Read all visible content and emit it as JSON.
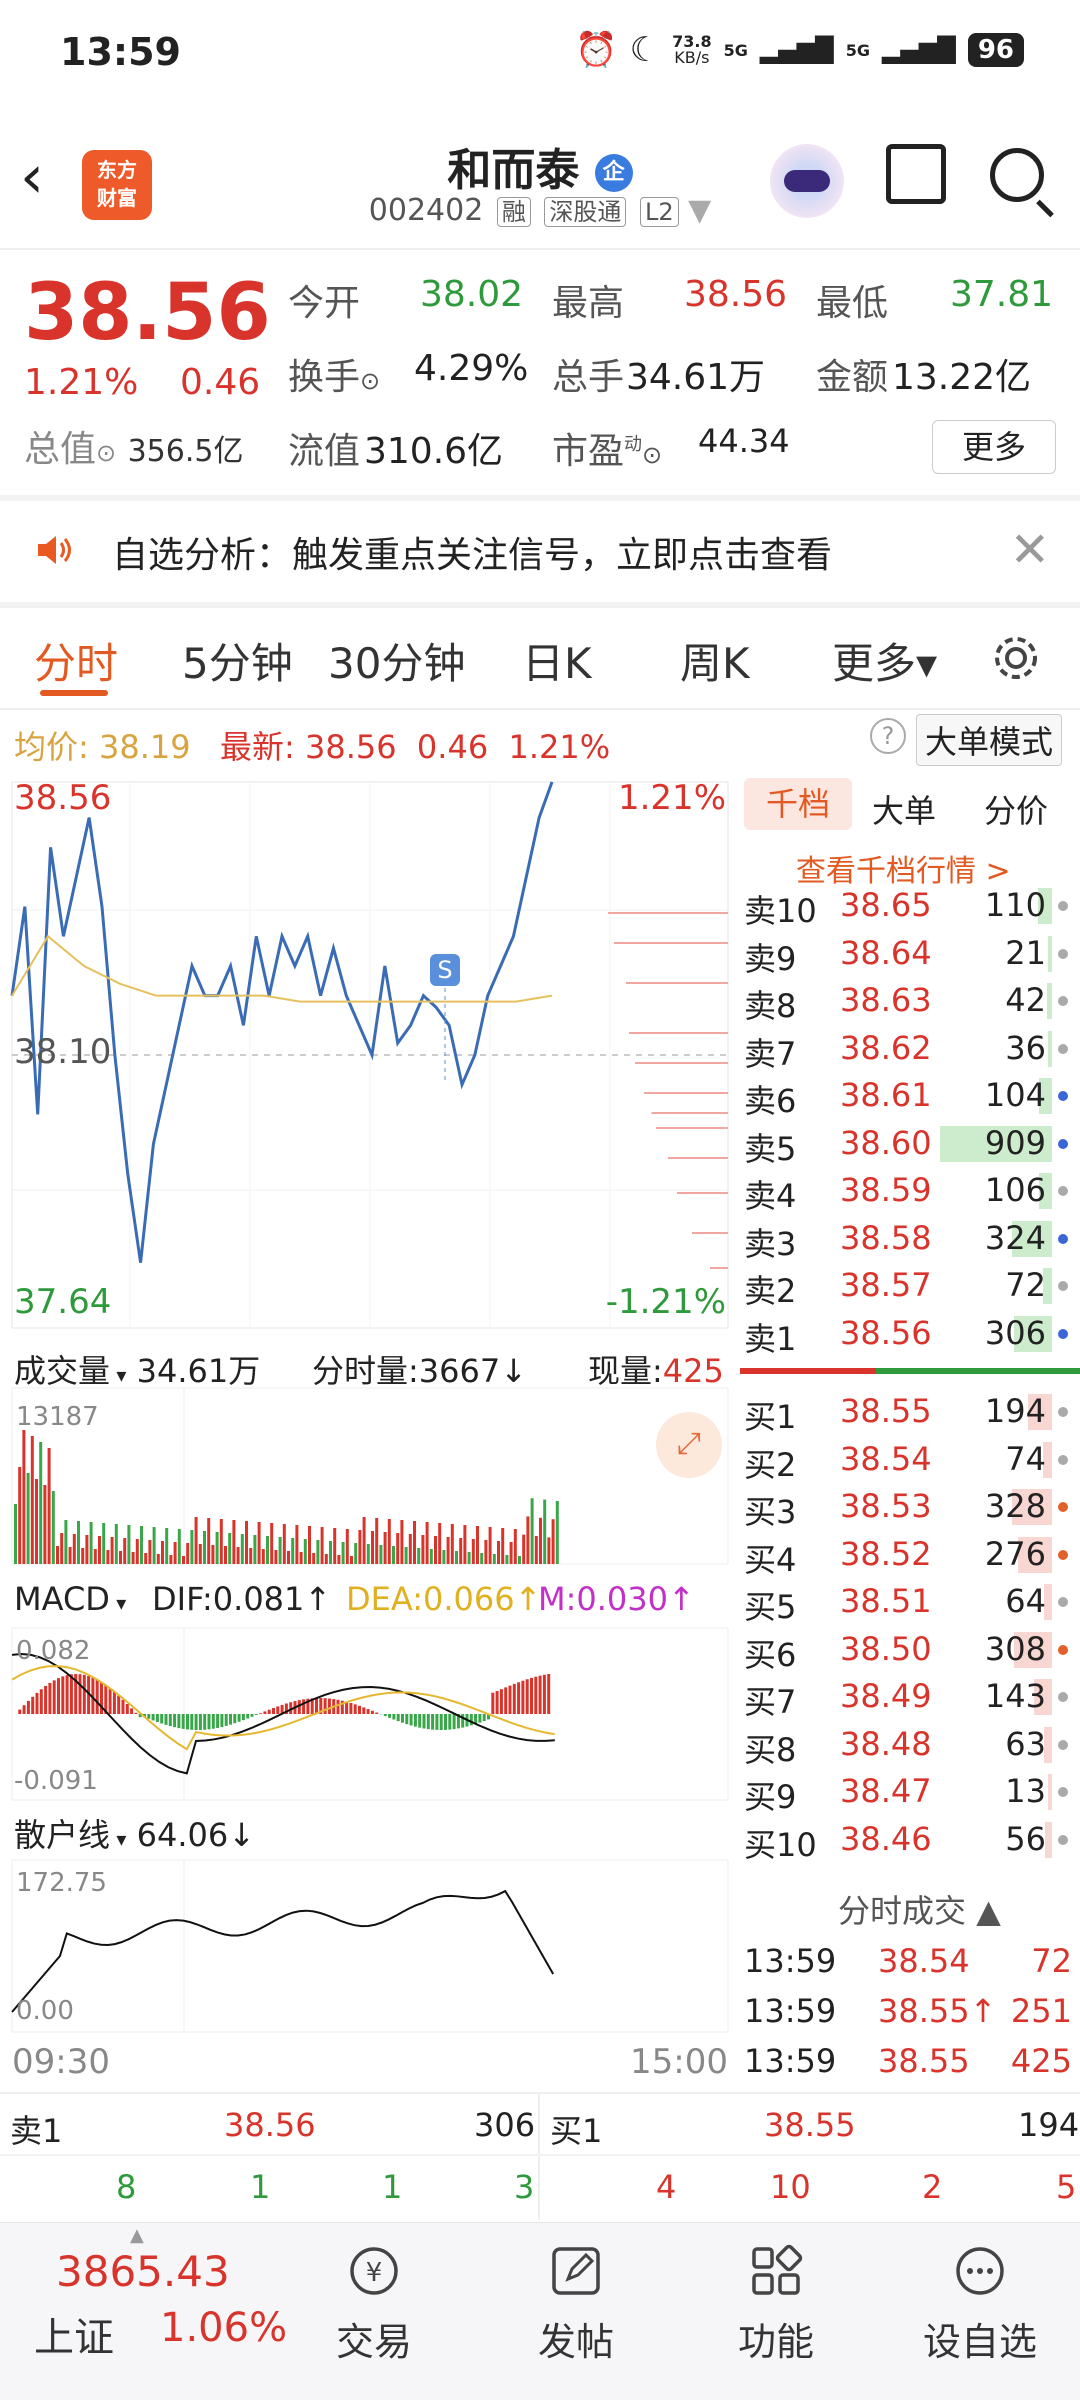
{
  "status": {
    "time": "13:59",
    "net_speed": "73.8",
    "net_unit": "KB/s",
    "sig1": "5G",
    "sig2": "5G",
    "battery": "96"
  },
  "header": {
    "logo_line1": "东方",
    "logo_line2": "财富",
    "name": "和而泰",
    "badge": "企",
    "code": "002402",
    "tag1": "融",
    "tag2": "深股通",
    "tag3": "L2"
  },
  "quote": {
    "price": "38.56",
    "pct": "1.21%",
    "chg": "0.46",
    "open_label": "今开",
    "open": "38.02",
    "high_label": "最高",
    "high": "38.56",
    "low_label": "最低",
    "low": "37.81",
    "turnover_label": "换手",
    "turnover": "4.29%",
    "vol_label": "总手",
    "vol": "34.61万",
    "amount_label": "金额",
    "amount": "13.22亿",
    "mcap_label": "总值",
    "mcap": "356.5亿",
    "float_label": "流值",
    "float": "310.6亿",
    "pe_label": "市盈",
    "pe_sup": "动",
    "pe": "44.34",
    "more": "更多"
  },
  "notice": {
    "text": "自选分析：触发重点关注信号，立即点击查看"
  },
  "tabs": [
    "分时",
    "5分钟",
    "30分钟",
    "日K",
    "周K",
    "更多▾"
  ],
  "infobar": {
    "avg_label": "均价:",
    "avg": "38.19",
    "latest_label": "最新:",
    "latest": "38.56",
    "chg": "0.46",
    "pct": "1.21%",
    "mode": "大单模式"
  },
  "chart_data": {
    "type": "line",
    "title": "",
    "x_start": "09:30",
    "x_end": "15:00",
    "ylim": [
      37.64,
      38.56
    ],
    "y_top_label": "38.56",
    "y_mid_label": "38.10",
    "y_bottom_label": "37.64",
    "pct_top": "1.21%",
    "pct_bottom": "-1.21%",
    "marker": "S",
    "series": [
      {
        "values": [
          38.2,
          38.35,
          38.0,
          38.45,
          38.3,
          38.4,
          38.5,
          38.35,
          38.1,
          37.9,
          37.75,
          37.95,
          38.05,
          38.15,
          38.25,
          38.2,
          38.2,
          38.25,
          38.15,
          38.3,
          38.2,
          38.3,
          38.25,
          38.3,
          38.2,
          38.28,
          38.2,
          38.15,
          38.1,
          38.25,
          38.12,
          38.15,
          38.2,
          38.18,
          38.15,
          38.05,
          38.1,
          38.2,
          38.25,
          38.3,
          38.4,
          38.5,
          38.56
        ]
      },
      {
        "values": [
          38.2,
          38.3,
          38.25,
          38.22,
          38.2,
          38.2,
          38.2,
          38.2,
          38.19,
          38.19,
          38.19,
          38.19,
          38.19,
          38.19,
          38.19,
          38.2
        ]
      }
    ],
    "volume": {
      "label": "成交量",
      "total": "34.61万",
      "tick_label": "分时量:3667",
      "now_label": "现量:",
      "now": "425",
      "max": "13187"
    },
    "macd": {
      "label": "MACD",
      "dif": "DIF:0.081",
      "dea": "DEA:0.066",
      "m": "M:0.030",
      "top": "0.082",
      "bottom": "-0.091"
    },
    "retail": {
      "label": "散户线",
      "value": "64.06",
      "top": "172.75",
      "bottom": "0.00"
    }
  },
  "sidepanel": {
    "tabs": [
      "千档",
      "大单",
      "分价"
    ],
    "link": "查看千档行情 >",
    "asks": [
      {
        "l": "卖10",
        "p": "38.65",
        "v": "110"
      },
      {
        "l": "卖9",
        "p": "38.64",
        "v": "21"
      },
      {
        "l": "卖8",
        "p": "38.63",
        "v": "42"
      },
      {
        "l": "卖7",
        "p": "38.62",
        "v": "36"
      },
      {
        "l": "卖6",
        "p": "38.61",
        "v": "104"
      },
      {
        "l": "卖5",
        "p": "38.60",
        "v": "909"
      },
      {
        "l": "卖4",
        "p": "38.59",
        "v": "106"
      },
      {
        "l": "卖3",
        "p": "38.58",
        "v": "324"
      },
      {
        "l": "卖2",
        "p": "38.57",
        "v": "72"
      },
      {
        "l": "卖1",
        "p": "38.56",
        "v": "306"
      }
    ],
    "bids": [
      {
        "l": "买1",
        "p": "38.55",
        "v": "194"
      },
      {
        "l": "买2",
        "p": "38.54",
        "v": "74"
      },
      {
        "l": "买3",
        "p": "38.53",
        "v": "328"
      },
      {
        "l": "买4",
        "p": "38.52",
        "v": "276"
      },
      {
        "l": "买5",
        "p": "38.51",
        "v": "64"
      },
      {
        "l": "买6",
        "p": "38.50",
        "v": "308"
      },
      {
        "l": "买7",
        "p": "38.49",
        "v": "143"
      },
      {
        "l": "买8",
        "p": "38.48",
        "v": "63"
      },
      {
        "l": "买9",
        "p": "38.47",
        "v": "13"
      },
      {
        "l": "买10",
        "p": "38.46",
        "v": "56"
      }
    ],
    "ticks_title": "分时成交",
    "ticks": [
      {
        "t": "13:59",
        "p": "38.54",
        "v": "72"
      },
      {
        "t": "13:59",
        "p": "38.55↑",
        "v": "251"
      },
      {
        "t": "13:59",
        "p": "38.55",
        "v": "425"
      }
    ]
  },
  "bottom": {
    "sell_label": "卖1",
    "sell_price": "38.56",
    "sell_vol": "306",
    "buy_label": "买1",
    "buy_price": "38.55",
    "buy_vol": "194",
    "left_counts": [
      "8",
      "1",
      "1",
      "3"
    ],
    "right_counts": [
      "4",
      "10",
      "2",
      "5"
    ]
  },
  "nav": {
    "index_value": "3865.43",
    "index_name": "上证",
    "index_pct": "1.06%",
    "items": [
      "交易",
      "发帖",
      "功能",
      "设自选"
    ]
  }
}
